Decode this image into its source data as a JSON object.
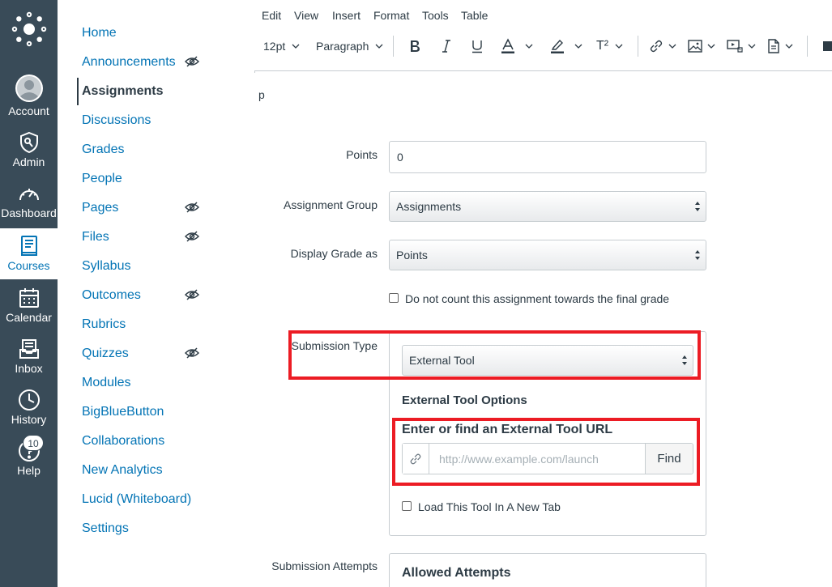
{
  "global_nav": {
    "items": [
      {
        "label": "Account",
        "icon": "user-avatar-icon"
      },
      {
        "label": "Admin",
        "icon": "shield-icon"
      },
      {
        "label": "Dashboard",
        "icon": "speedometer-icon"
      },
      {
        "label": "Courses",
        "icon": "book-icon",
        "active": true
      },
      {
        "label": "Calendar",
        "icon": "calendar-icon"
      },
      {
        "label": "Inbox",
        "icon": "inbox-icon"
      },
      {
        "label": "History",
        "icon": "clock-icon"
      },
      {
        "label": "Help",
        "icon": "help-icon",
        "badge": "10"
      }
    ],
    "colors": {
      "background": "#394b58",
      "active": "#0374b5"
    }
  },
  "course_nav": {
    "items": [
      {
        "label": "Home"
      },
      {
        "label": "Announcements",
        "hidden": true
      },
      {
        "label": "Assignments",
        "active": true
      },
      {
        "label": "Discussions"
      },
      {
        "label": "Grades"
      },
      {
        "label": "People"
      },
      {
        "label": "Pages",
        "hidden": true
      },
      {
        "label": "Files",
        "hidden": true
      },
      {
        "label": "Syllabus"
      },
      {
        "label": "Outcomes",
        "hidden": true
      },
      {
        "label": "Rubrics"
      },
      {
        "label": "Quizzes",
        "hidden": true
      },
      {
        "label": "Modules"
      },
      {
        "label": "BigBlueButton"
      },
      {
        "label": "Collaborations"
      },
      {
        "label": "New Analytics"
      },
      {
        "label": "Lucid (Whiteboard)"
      },
      {
        "label": "Settings"
      }
    ],
    "link_color": "#0374b5"
  },
  "editor": {
    "menu": [
      "Edit",
      "View",
      "Insert",
      "Format",
      "Tools",
      "Table"
    ],
    "toolbar": {
      "font_size": "12pt",
      "block_format": "Paragraph",
      "superscript": "T²"
    },
    "path": "p"
  },
  "form": {
    "points": {
      "label": "Points",
      "value": "0"
    },
    "assignment_group": {
      "label": "Assignment Group",
      "value": "Assignments"
    },
    "display_grade": {
      "label": "Display Grade as",
      "value": "Points"
    },
    "exclude_final": {
      "label": "Do not count this assignment towards the final grade",
      "checked": false
    },
    "submission_type": {
      "label": "Submission Type",
      "value": "External Tool"
    },
    "external_tool": {
      "heading": "External Tool Options",
      "url_label": "Enter or find an External Tool URL",
      "url_placeholder": "http://www.example.com/launch",
      "find_label": "Find",
      "new_tab": {
        "label": "Load This Tool In A New Tab",
        "checked": false
      }
    },
    "submission_attempts": {
      "label": "Submission Attempts",
      "heading": "Allowed Attempts"
    }
  },
  "highlight_color": "#ec1c24"
}
